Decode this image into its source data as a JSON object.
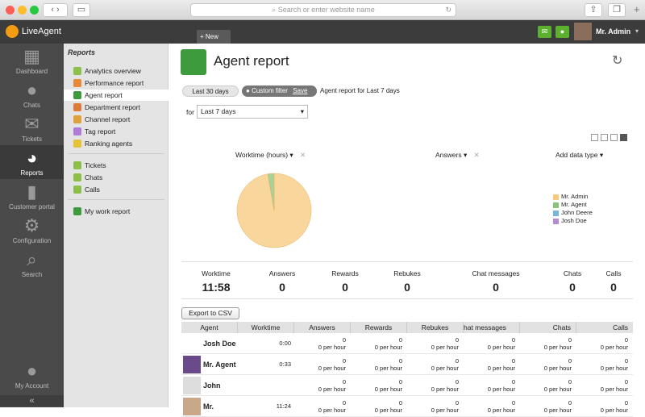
{
  "browser": {
    "url_placeholder": "Search or enter website name"
  },
  "app": {
    "logo": "LiveAgent",
    "new_tab": "New",
    "user": "Mr. Admin"
  },
  "sidebar": [
    {
      "label": "Dashboard"
    },
    {
      "label": "Chats"
    },
    {
      "label": "Tickets"
    },
    {
      "label": "Reports"
    },
    {
      "label": "Customer portal"
    },
    {
      "label": "Configuration"
    },
    {
      "label": "Search"
    },
    {
      "label": "My Account"
    }
  ],
  "subnav": {
    "title": "Reports",
    "group1": [
      "Analytics overview",
      "Performance report",
      "Agent report",
      "Department report",
      "Channel report",
      "Tag report",
      "Ranking agents"
    ],
    "group2": [
      "Tickets",
      "Chats",
      "Calls"
    ],
    "group3": [
      "My work report"
    ]
  },
  "page": {
    "title": "Agent report",
    "filter_last30": "Last 30 days",
    "filter_custom": "Custom filter",
    "save": "Save",
    "filter_desc": "Agent report for Last 7 days",
    "for_label": "for",
    "period": "Last 7 days"
  },
  "chart_controls": {
    "metric1": "Worktime (hours)",
    "metric2": "Answers",
    "add_type": "Add data type"
  },
  "chart_data": {
    "type": "pie",
    "series": [
      {
        "name": "Mr. Admin",
        "value": 11.64
      },
      {
        "name": "Mr. Agent",
        "value": 0.33
      },
      {
        "name": "John Deere",
        "value": 0
      },
      {
        "name": "Josh Doe",
        "value": 0
      }
    ],
    "colors": [
      "#f7c97b",
      "#8cc37a",
      "#7ab3d8",
      "#b48cd4"
    ],
    "legend_position": "right"
  },
  "stats": [
    {
      "label": "Worktime",
      "value": "11:58"
    },
    {
      "label": "Answers",
      "value": "0"
    },
    {
      "label": "Rewards",
      "value": "0"
    },
    {
      "label": "Rebukes",
      "value": "0"
    },
    {
      "label": "Chat messages",
      "value": "0"
    },
    {
      "label": "Chats",
      "value": "0"
    },
    {
      "label": "Calls",
      "value": "0"
    }
  ],
  "table": {
    "export": "Export to CSV",
    "headers": [
      "Agent",
      "Worktime",
      "Answers",
      "Rewards",
      "Rebukes",
      "hat messages",
      "Chats",
      "Calls"
    ],
    "per_hour": "0 per hour",
    "zero": "0",
    "rows": [
      {
        "name": "Josh Doe",
        "worktime": "0:00"
      },
      {
        "name": "Mr. Agent",
        "worktime": "0:33"
      },
      {
        "name": "John",
        "worktime": ""
      },
      {
        "name": "Mr.",
        "worktime": "11:24"
      }
    ]
  }
}
